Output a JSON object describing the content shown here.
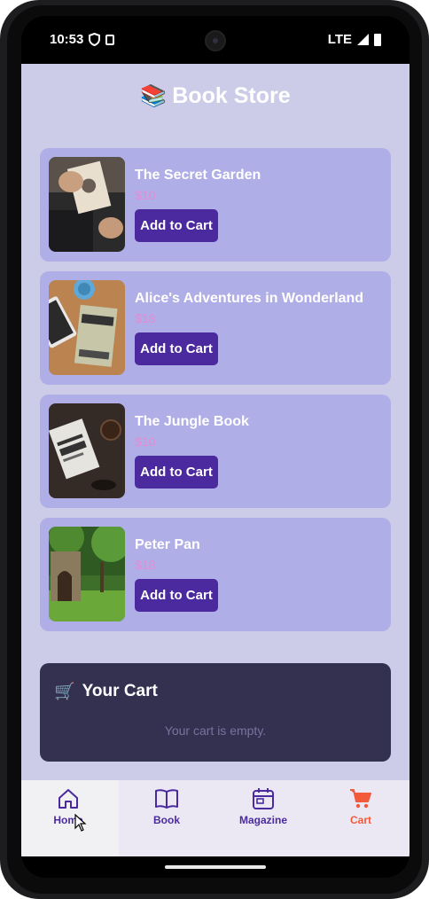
{
  "status_bar": {
    "time": "10:53",
    "network": "LTE"
  },
  "app": {
    "title": "Book Store",
    "title_emoji": "📚",
    "add_button_label": "Add to Cart"
  },
  "books": [
    {
      "title": "The Secret Garden",
      "price": "$10"
    },
    {
      "title": "Alice's Adventures in Wonderland",
      "price": "$18"
    },
    {
      "title": "The Jungle Book",
      "price": "$10"
    },
    {
      "title": "Peter Pan",
      "price": "$18"
    }
  ],
  "cart": {
    "emoji": "🛒",
    "heading": "Your Cart",
    "empty_message": "Your cart is empty."
  },
  "nav": [
    {
      "label": "Home",
      "icon": "home-icon"
    },
    {
      "label": "Book",
      "icon": "book-icon"
    },
    {
      "label": "Magazine",
      "icon": "calendar-icon"
    },
    {
      "label": "Cart",
      "icon": "cart-icon"
    }
  ],
  "colors": {
    "background": "#cccbe8",
    "card": "#b0aee6",
    "button": "#4a2a9e",
    "price": "#e88ad6",
    "cart_panel": "#343050",
    "cart_accent": "#f25a3a"
  }
}
